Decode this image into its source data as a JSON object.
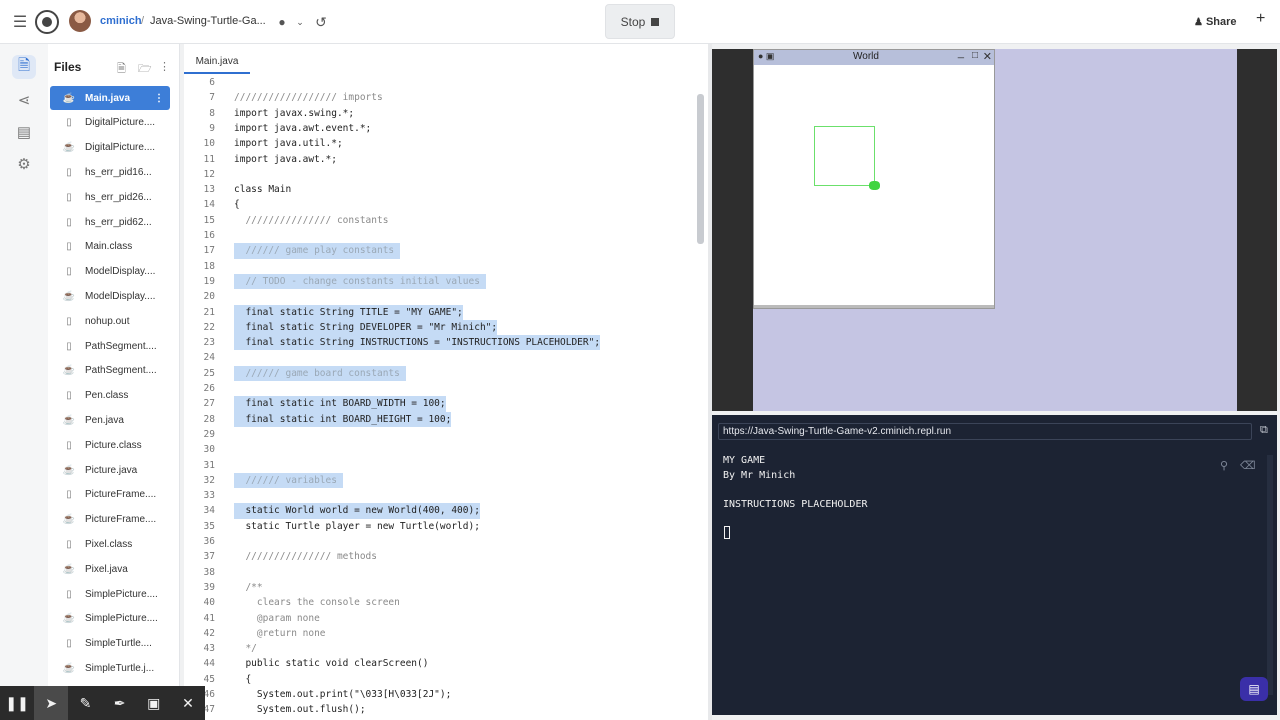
{
  "topbar": {
    "user": "cminich",
    "separator": "/",
    "repl_name": "Java-Swing-Turtle-Ga...",
    "run_label": "Stop",
    "share_label": "Share",
    "plus_label": "+"
  },
  "files_panel": {
    "title": "Files",
    "items": [
      {
        "name": "Main.java",
        "icon": "coffee-icon",
        "active": true
      },
      {
        "name": "DigitalPicture....",
        "icon": "file-icon"
      },
      {
        "name": "DigitalPicture....",
        "icon": "coffee-icon"
      },
      {
        "name": "hs_err_pid16...",
        "icon": "file-icon"
      },
      {
        "name": "hs_err_pid26...",
        "icon": "file-icon"
      },
      {
        "name": "hs_err_pid62...",
        "icon": "file-icon"
      },
      {
        "name": "Main.class",
        "icon": "file-icon"
      },
      {
        "name": "ModelDisplay....",
        "icon": "file-icon"
      },
      {
        "name": "ModelDisplay....",
        "icon": "coffee-icon"
      },
      {
        "name": "nohup.out",
        "icon": "file-icon"
      },
      {
        "name": "PathSegment....",
        "icon": "file-icon"
      },
      {
        "name": "PathSegment....",
        "icon": "coffee-icon"
      },
      {
        "name": "Pen.class",
        "icon": "file-icon"
      },
      {
        "name": "Pen.java",
        "icon": "coffee-icon"
      },
      {
        "name": "Picture.class",
        "icon": "file-icon"
      },
      {
        "name": "Picture.java",
        "icon": "coffee-icon"
      },
      {
        "name": "PictureFrame....",
        "icon": "file-icon"
      },
      {
        "name": "PictureFrame....",
        "icon": "coffee-icon"
      },
      {
        "name": "Pixel.class",
        "icon": "file-icon"
      },
      {
        "name": "Pixel.java",
        "icon": "coffee-icon"
      },
      {
        "name": "SimplePicture....",
        "icon": "file-icon"
      },
      {
        "name": "SimplePicture....",
        "icon": "coffee-icon"
      },
      {
        "name": "SimpleTurtle....",
        "icon": "file-icon"
      },
      {
        "name": "SimpleTurtle.j...",
        "icon": "coffee-icon"
      }
    ]
  },
  "editor": {
    "tab": "Main.java",
    "lines": [
      {
        "n": "6",
        "t": ""
      },
      {
        "n": "7",
        "t": "////////////////// imports",
        "cmt": true
      },
      {
        "n": "8",
        "t": "import javax.swing.*;"
      },
      {
        "n": "9",
        "t": "import java.awt.event.*;"
      },
      {
        "n": "10",
        "t": "import java.util.*;"
      },
      {
        "n": "11",
        "t": "import java.awt.*;"
      },
      {
        "n": "12",
        "t": ""
      },
      {
        "n": "13",
        "t": "class Main"
      },
      {
        "n": "14",
        "t": "{"
      },
      {
        "n": "15",
        "t": "  /////////////// constants",
        "cmt": true
      },
      {
        "n": "16",
        "t": "",
        "sel": true
      },
      {
        "n": "17",
        "t": "  ////// game play constants ",
        "cmt": true,
        "sel": true
      },
      {
        "n": "18",
        "t": "",
        "sel": true
      },
      {
        "n": "19",
        "t": "  // TODO - change constants initial values ",
        "cmt": true,
        "sel": true
      },
      {
        "n": "20",
        "t": "",
        "sel": true
      },
      {
        "n": "21",
        "t": "  final static String TITLE = \"MY GAME\";",
        "sel": true
      },
      {
        "n": "22",
        "t": "  final static String DEVELOPER = \"Mr Minich\";",
        "sel": true
      },
      {
        "n": "23",
        "t": "  final static String INSTRUCTIONS = \"INSTRUCTIONS PLACEHOLDER\";",
        "sel": true
      },
      {
        "n": "24",
        "t": "",
        "sel": true
      },
      {
        "n": "25",
        "t": "  ////// game board constants ",
        "cmt": true,
        "sel": true
      },
      {
        "n": "26",
        "t": "",
        "sel": true
      },
      {
        "n": "27",
        "t": "  final static int BOARD_WIDTH = 100;",
        "sel": true
      },
      {
        "n": "28",
        "t": "  final static int BOARD_HEIGHT = 100;",
        "sel": true
      },
      {
        "n": "29",
        "t": "",
        "sel": true
      },
      {
        "n": "30",
        "t": "",
        "sel": true
      },
      {
        "n": "31",
        "t": "",
        "sel": true
      },
      {
        "n": "32",
        "t": "  ////// variables ",
        "cmt": true,
        "sel": true
      },
      {
        "n": "33",
        "t": "",
        "sel": true
      },
      {
        "n": "34",
        "t": "  static World world = new World(400, 400);",
        "sel": true
      },
      {
        "n": "35",
        "t": "  static Turtle player = new Turtle(world);"
      },
      {
        "n": "36",
        "t": ""
      },
      {
        "n": "37",
        "t": "  /////////////// methods",
        "cmt": true
      },
      {
        "n": "38",
        "t": ""
      },
      {
        "n": "39",
        "t": "  /**",
        "cmt": true
      },
      {
        "n": "40",
        "t": "    clears the console screen",
        "cmt": true
      },
      {
        "n": "41",
        "t": "    @param none",
        "cmt": true
      },
      {
        "n": "42",
        "t": "    @return none",
        "cmt": true
      },
      {
        "n": "43",
        "t": "  */",
        "cmt": true
      },
      {
        "n": "44",
        "t": "  public static void clearScreen()"
      },
      {
        "n": "45",
        "t": "  {"
      },
      {
        "n": "46",
        "t": "    System.out.print(\"\\033[H\\033[2J\");"
      },
      {
        "n": "47",
        "t": "    System.out.flush();"
      }
    ]
  },
  "world_window": {
    "title": "World"
  },
  "console": {
    "url": "https://Java-Swing-Turtle-Game-v2.cminich.repl.run",
    "output": [
      "MY GAME",
      "By Mr Minich",
      "",
      "INSTRUCTIONS PLACEHOLDER"
    ]
  },
  "colors": {
    "accent": "#3d7ed8",
    "selection": "#c5dbf5",
    "console_bg": "#1c2333",
    "turtle": "#3fd43f"
  }
}
